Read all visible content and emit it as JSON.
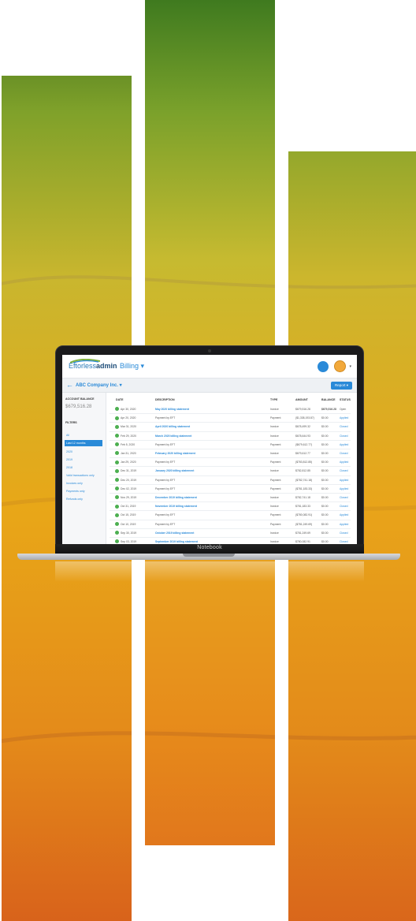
{
  "colors": {
    "accent": "#2a8ad8",
    "brand_dark": "#1f4e79",
    "status_ok": "#4caf50",
    "background": "#ffffff"
  },
  "app": {
    "logo_prefix": "Eftorless",
    "logo_suffix": "admin",
    "title": "Billing ▾",
    "company": "ABC Company Inc. ▾",
    "report_button": "Report ▾",
    "laptop_label": "Notebook"
  },
  "sidebar": {
    "account_balance_label": "ACCOUNT BALANCE",
    "account_balance_value": "$679,516.28",
    "filters_label": "FILTERS",
    "items": [
      "All",
      "Last 12 months",
      "2020",
      "2019",
      "2018",
      "Valid transactions only",
      "Invoices only",
      "Payments only",
      "Refunds only"
    ]
  },
  "table": {
    "headers": [
      "DATE",
      "DESCRIPTION",
      "TYPE",
      "AMOUNT",
      "BALANCE",
      "STATUS"
    ],
    "rows": [
      [
        "Apr 30, 2020",
        "May 2020 billing statement",
        "Invoice",
        "$679,516.28",
        "$679,516.28",
        "Open"
      ],
      [
        "Apr 20, 2020",
        "Payment by EFT",
        "Payment",
        "($1,338,193.87)",
        "$0.00",
        "Applied"
      ],
      [
        "Mar 31, 2020",
        "April 2020 billing statement",
        "Invoice",
        "$678,499.32",
        "$0.00",
        "Closed"
      ],
      [
        "Feb 29, 2020",
        "March 2020 billing statement",
        "Invoice",
        "$678,644.93",
        "$0.00",
        "Closed"
      ],
      [
        "Feb 5, 2020",
        "Payment by EFT",
        "Payment",
        "($679,612.77)",
        "$0.00",
        "Applied"
      ],
      [
        "Jan 31, 2020",
        "February 2020 billing statement",
        "Invoice",
        "$679,612.77",
        "$0.00",
        "Closed"
      ],
      [
        "Jan 29, 2020",
        "Payment by EFT",
        "Payment",
        "($783,812.85)",
        "$0.00",
        "Applied"
      ],
      [
        "Dec 31, 2019",
        "January 2020 billing statement",
        "Invoice",
        "$782,812.85",
        "$0.00",
        "Closed"
      ],
      [
        "Dec 20, 2019",
        "Payment by EFT",
        "Payment",
        "($782,741.18)",
        "$0.00",
        "Applied"
      ],
      [
        "Dec 02, 2019",
        "Payment by EFT",
        "Payment",
        "($781,183.33)",
        "$0.00",
        "Applied"
      ],
      [
        "Nov 29, 2019",
        "December 2019 billing statement",
        "Invoice",
        "$782,741.18",
        "$0.00",
        "Closed"
      ],
      [
        "Oct 31, 2019",
        "November 2019 billing statement",
        "Invoice",
        "$781,183.33",
        "$0.00",
        "Closed"
      ],
      [
        "Oct 15, 2019",
        "Payment by EFT",
        "Payment",
        "($780,082.91)",
        "$0.00",
        "Applied"
      ],
      [
        "Oct 10, 2019",
        "Payment by EFT",
        "Payment",
        "($781,249.69)",
        "$0.00",
        "Applied"
      ],
      [
        "Sep 30, 2019",
        "October 2019 billing statement",
        "Invoice",
        "$781,249.69",
        "$0.00",
        "Closed"
      ],
      [
        "Sep 03, 2019",
        "September 2019 billing statement",
        "Invoice",
        "$780,082.91",
        "$0.00",
        "Closed"
      ]
    ]
  }
}
